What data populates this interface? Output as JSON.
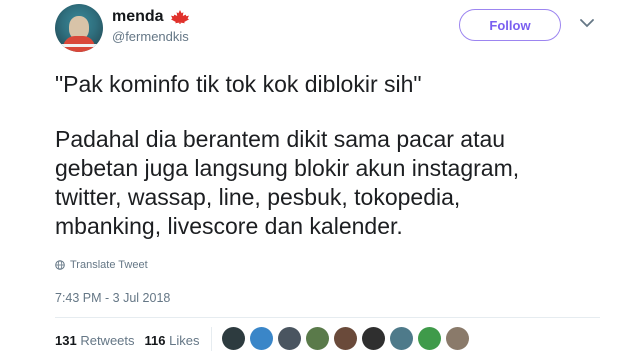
{
  "user": {
    "name": "menda",
    "handle": "@fermendkis"
  },
  "follow_label": "Follow",
  "tweet": {
    "quote": "\"Pak kominfo tik tok kok diblokir sih\"",
    "body_lines": [
      "Padahal dia berantem dikit sama pacar atau",
      "gebetan juga langsung blokir akun instagram,",
      "twitter, wassap, line, pesbuk, tokopedia,",
      "mbanking, livescore dan kalender."
    ]
  },
  "translate_label": "Translate Tweet",
  "timestamp": "7:43 PM - 3 Jul 2018",
  "stats": {
    "retweets_count": "131",
    "retweets_label": "Retweets",
    "likes_count": "116",
    "likes_label": "Likes"
  },
  "icons": {
    "flag": "canada-maple-leaf-icon",
    "translate": "globe-icon",
    "menu": "chevron-down-icon"
  },
  "colors": {
    "accent": "#7a5ff0",
    "muted": "#657786",
    "text": "#1c1e21",
    "leaf": "#e0312b"
  },
  "liker_avatar_colors": [
    "#2d3b3f",
    "#3a86c8",
    "#4a5560",
    "#5a7a4a",
    "#6a4a3a",
    "#2f2f2f",
    "#4e7a8a",
    "#3f9a4a",
    "#8a7a6a"
  ]
}
